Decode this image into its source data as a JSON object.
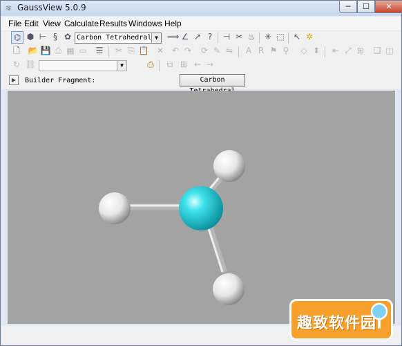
{
  "window": {
    "title": "GaussView 5.0.9",
    "controls": {
      "minimize": "─",
      "maximize": "☐",
      "close": "✕"
    }
  },
  "menubar": {
    "items": [
      "File",
      "Edit",
      "View",
      "Calculate",
      "Results",
      "Windows",
      "Help"
    ]
  },
  "toolbar": {
    "element_combo": {
      "value": "Carbon Tetrahedral"
    },
    "builder_combo": {
      "value": ""
    }
  },
  "builder": {
    "label": "Builder Fragment:",
    "fragment_button": "Carbon Tetrahedral"
  },
  "viewport": {
    "background": "#a3a3a3",
    "atoms": [
      {
        "element": "C",
        "color": "#19cbd6"
      },
      {
        "element": "H",
        "color": "#f2f2f2"
      },
      {
        "element": "H",
        "color": "#f2f2f2"
      },
      {
        "element": "H",
        "color": "#f2f2f2"
      }
    ]
  },
  "watermark": {
    "text": "趣致软件园"
  }
}
